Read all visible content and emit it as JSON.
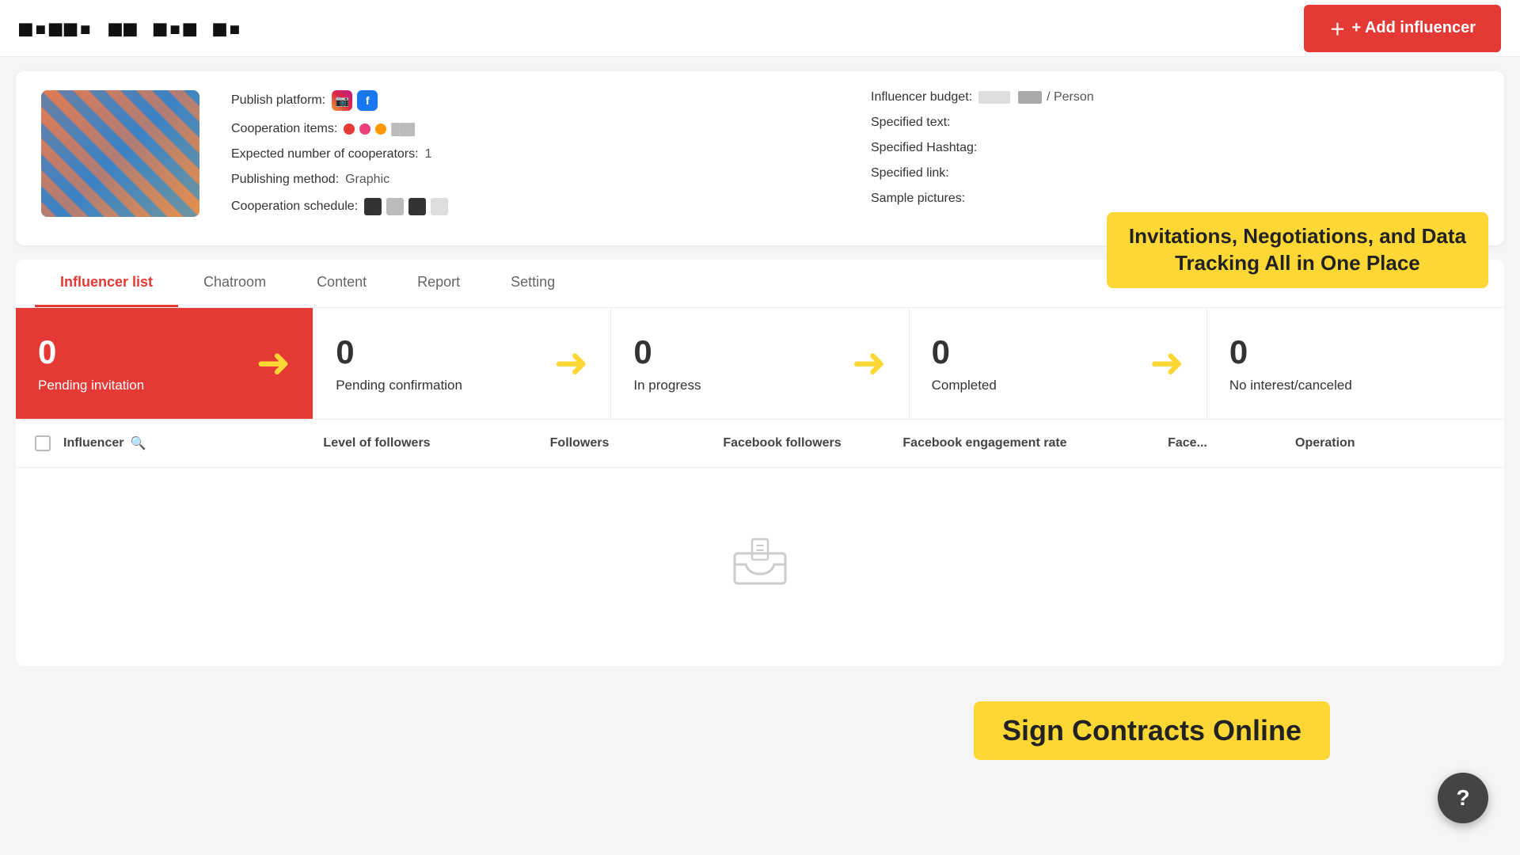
{
  "header": {
    "logo_text": "■▪■▪ ■■■▪ ■▪■ ■▪",
    "add_influencer_label": "+ Add influencer"
  },
  "campaign": {
    "publish_platform_label": "Publish platform:",
    "cooperation_items_label": "Cooperation items:",
    "expected_cooperators_label": "Expected number of cooperators:",
    "expected_cooperators_value": "1",
    "publishing_method_label": "Publishing method:",
    "publishing_method_value": "Graphic",
    "cooperation_schedule_label": "Cooperation schedule:",
    "influencer_budget_label": "Influencer budget:",
    "influencer_budget_value": "/ Person",
    "specified_text_label": "Specified text:",
    "specified_hashtag_label": "Specified Hashtag:",
    "specified_link_label": "Specified link:",
    "sample_pictures_label": "Sample pictures:"
  },
  "tabs": {
    "items": [
      {
        "label": "Influencer list",
        "active": true
      },
      {
        "label": "Chatroom",
        "active": false
      },
      {
        "label": "Content",
        "active": false
      },
      {
        "label": "Report",
        "active": false
      },
      {
        "label": "Setting",
        "active": false
      }
    ],
    "promo_banner": {
      "line1": "Invitations, Negotiations, and Data",
      "line2": "Tracking All in One Place"
    }
  },
  "status_cards": [
    {
      "count": "0",
      "label": "Pending invitation",
      "active": true
    },
    {
      "count": "0",
      "label": "Pending confirmation",
      "active": false
    },
    {
      "count": "0",
      "label": "In progress",
      "active": false
    },
    {
      "count": "0",
      "label": "Completed",
      "active": false
    },
    {
      "count": "0",
      "label": "No interest/canceled",
      "active": false
    }
  ],
  "table": {
    "columns": [
      {
        "label": "Influencer"
      },
      {
        "label": "Level of followers"
      },
      {
        "label": "Followers"
      },
      {
        "label": "Facebook followers"
      },
      {
        "label": "Facebook engagement rate"
      },
      {
        "label": "Face..."
      },
      {
        "label": "Operation"
      }
    ]
  },
  "sign_contracts_banner": "Sign Contracts Online",
  "help_button_label": "?"
}
